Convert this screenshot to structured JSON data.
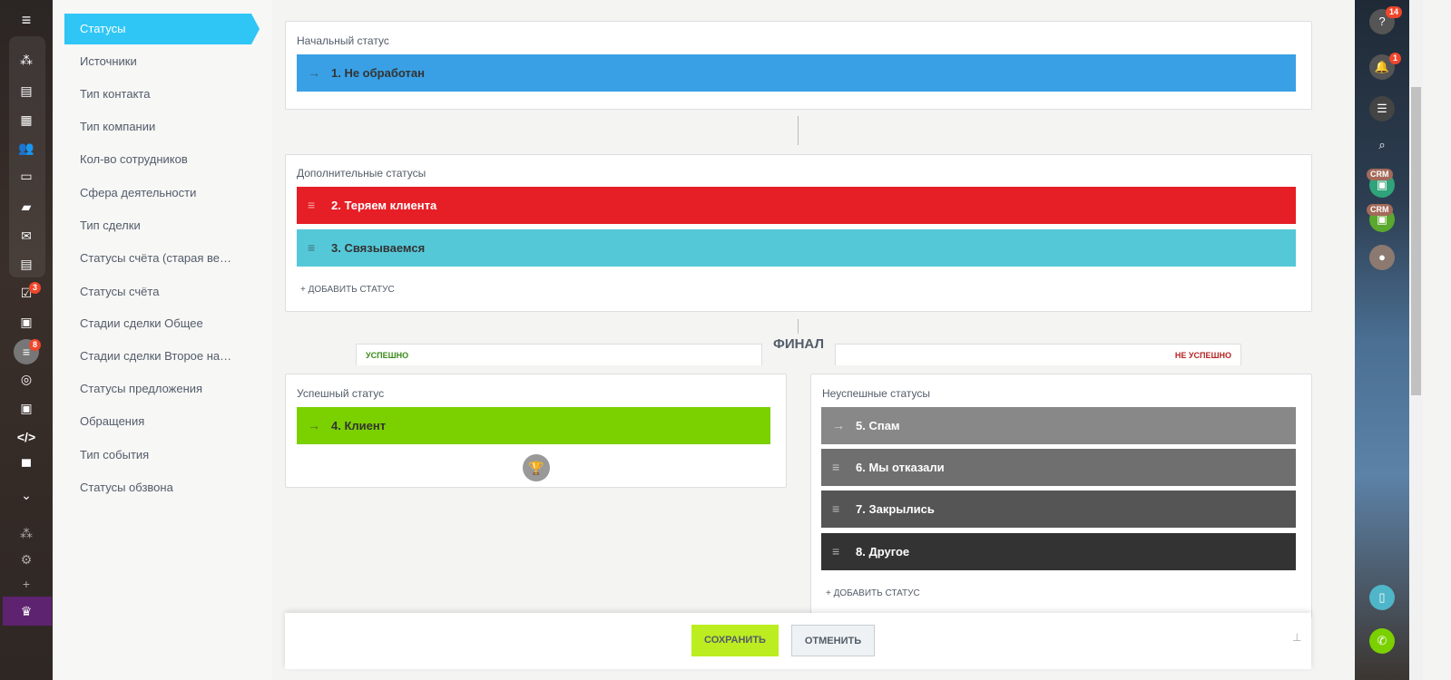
{
  "left_nav": {
    "badges": {
      "tasks": "3",
      "filter": "8"
    }
  },
  "menu": {
    "items": [
      "Статусы",
      "Источники",
      "Тип контакта",
      "Тип компании",
      "Кол-во сотрудников",
      "Сфера деятельности",
      "Тип сделки",
      "Статусы счёта (старая ве…",
      "Статусы счёта",
      "Стадии сделки Общее",
      "Стадии сделки Второе на…",
      "Статусы предложения",
      "Обращения",
      "Тип события",
      "Статусы обзвона"
    ]
  },
  "initial": {
    "label": "Начальный статус",
    "status": "1. Не обработан",
    "color": "#39a0e5"
  },
  "extra": {
    "label": "Дополнительные статусы",
    "statuses": [
      {
        "name": "2. Теряем клиента",
        "color": "#e61e26"
      },
      {
        "name": "3. Связываемся",
        "color": "#55c8d8"
      }
    ],
    "add": "+ ДОБАВИТЬ СТАТУС"
  },
  "final": {
    "title": "ФИНАЛ",
    "success_tab": "УСПЕШНО",
    "fail_tab": "НЕ УСПЕШНО"
  },
  "success": {
    "label": "Успешный статус",
    "status": "4. Клиент",
    "color": "#7bd000"
  },
  "fail": {
    "label": "Неуспешные статусы",
    "statuses": [
      {
        "name": "5. Спам",
        "color": "#888888"
      },
      {
        "name": "6. Мы отказали",
        "color": "#6f6f6f"
      },
      {
        "name": "7. Закрылись",
        "color": "#555555"
      },
      {
        "name": "8. Другое",
        "color": "#333333"
      }
    ],
    "add": "+ ДОБАВИТЬ СТАТУС"
  },
  "footer": {
    "save": "СОХРАНИТЬ",
    "cancel": "ОТМЕНИТЬ"
  },
  "right_bar": {
    "help_badge": "14",
    "notif_badge": "1",
    "crm_label": "CRM"
  }
}
